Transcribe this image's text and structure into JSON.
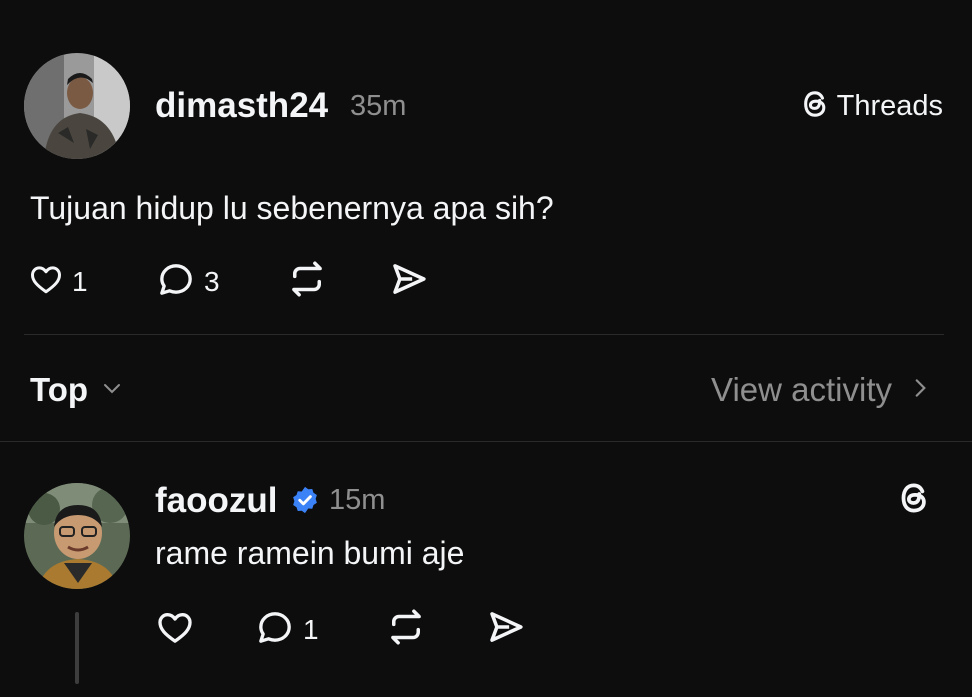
{
  "app": {
    "brand": "Threads"
  },
  "post": {
    "username": "dimasth24",
    "time": "35m",
    "text": "Tujuan hidup lu sebenernya apa sih?",
    "likes": "1",
    "replies": "3"
  },
  "sort": {
    "label": "Top",
    "view_activity": "View activity"
  },
  "reply": {
    "username": "faoozul",
    "time": "15m",
    "text": "rame ramein bumi aje",
    "replies": "1",
    "verified": true
  },
  "colors": {
    "background": "#0d0d0d",
    "text": "#f3f5f7",
    "muted": "#8f8f8f",
    "verified": "#3b82f6",
    "divider": "#2a2a2a"
  },
  "icons": [
    "heart-icon",
    "comment-icon",
    "repost-icon",
    "share-icon",
    "threads-logo-icon",
    "chevron-down-icon",
    "chevron-right-icon",
    "verified-icon"
  ]
}
